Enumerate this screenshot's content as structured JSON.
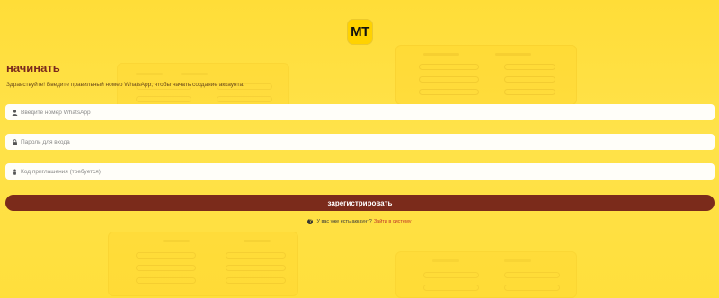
{
  "brand": {
    "logo_text": "MT",
    "logo_color": "#ffd200"
  },
  "header": {
    "title": "начинать",
    "subtitle": "Здравствуйте! Введите правильный номер WhatsApp, чтобы начать создание аккаунта."
  },
  "form": {
    "phone": {
      "placeholder": "Введите номер WhatsApp",
      "value": "",
      "icon": "user-icon"
    },
    "password": {
      "placeholder": "Пароль для входа",
      "value": "",
      "icon": "lock-icon"
    },
    "invite": {
      "placeholder": "Код приглашения (требуется)",
      "value": "",
      "icon": "person-icon"
    },
    "submit_label": "зарегистрировать"
  },
  "footer": {
    "question": "У вас уже есть аккаунт?",
    "login_link": "Зайти в систему",
    "icon": "question-icon"
  },
  "colors": {
    "background": "#ffdf3a",
    "accent": "#7b2b1b",
    "link": "#c0392b",
    "title": "#7a2a1e"
  }
}
